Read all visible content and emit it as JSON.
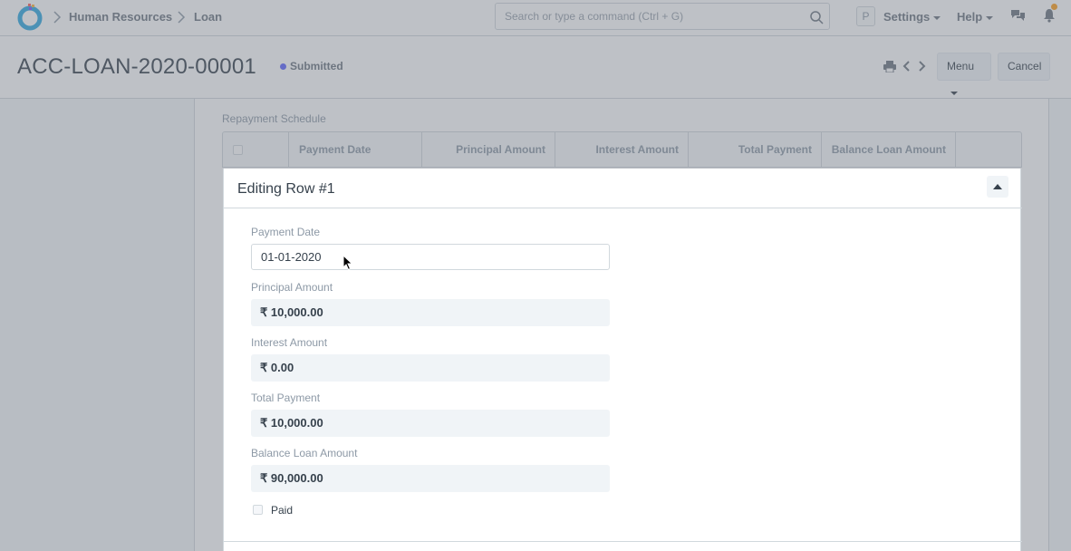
{
  "navbar": {
    "breadcrumbs": [
      "Human Resources",
      "Loan"
    ],
    "search_placeholder": "Search or type a command (Ctrl + G)",
    "avatar_initial": "P",
    "settings_label": "Settings",
    "help_label": "Help"
  },
  "page": {
    "title": "ACC-LOAN-2020-00001",
    "status": "Submitted",
    "menu_label": "Menu",
    "cancel_label": "Cancel"
  },
  "schedule": {
    "section_label": "Repayment Schedule",
    "columns": [
      "Payment Date",
      "Principal Amount",
      "Interest Amount",
      "Total Payment",
      "Balance Loan Amount"
    ]
  },
  "edit_row": {
    "title": "Editing Row #1",
    "fields": {
      "payment_date": {
        "label": "Payment Date",
        "value": "01-01-2020"
      },
      "principal_amount": {
        "label": "Principal Amount",
        "value": "₹ 10,000.00"
      },
      "interest_amount": {
        "label": "Interest Amount",
        "value": "₹ 0.00"
      },
      "total_payment": {
        "label": "Total Payment",
        "value": "₹ 10,000.00"
      },
      "balance_loan_amount": {
        "label": "Balance Loan Amount",
        "value": "₹ 90,000.00"
      }
    },
    "paid_label": "Paid"
  },
  "colors": {
    "accent": "#5e64ff",
    "notification": "#ff9f1a"
  }
}
